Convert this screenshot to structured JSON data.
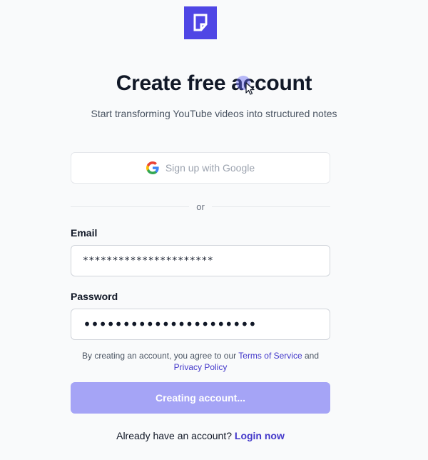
{
  "logo": {
    "icon": "document-icon",
    "color": "#4f46e5"
  },
  "header": {
    "title": "Create free account",
    "subtitle": "Start transforming YouTube videos into structured notes"
  },
  "google_button": {
    "label": "Sign up with Google",
    "icon": "google-icon"
  },
  "divider": {
    "label": "or"
  },
  "form": {
    "email": {
      "label": "Email",
      "value": "**********************"
    },
    "password": {
      "label": "Password",
      "value": "••••••••••••••••••••••"
    }
  },
  "terms": {
    "prefix": "By creating an account, you agree to our",
    "terms_link": "Terms of Service",
    "conjunction": "and",
    "privacy_link": "Privacy Policy"
  },
  "submit": {
    "label": "Creating account...",
    "color": "#a5a4f6"
  },
  "footer": {
    "prompt": "Already have an account?",
    "login_link": "Login now"
  },
  "colors": {
    "accent": "#4f46e5",
    "link": "#4338ca",
    "background": "#f9fafb"
  }
}
